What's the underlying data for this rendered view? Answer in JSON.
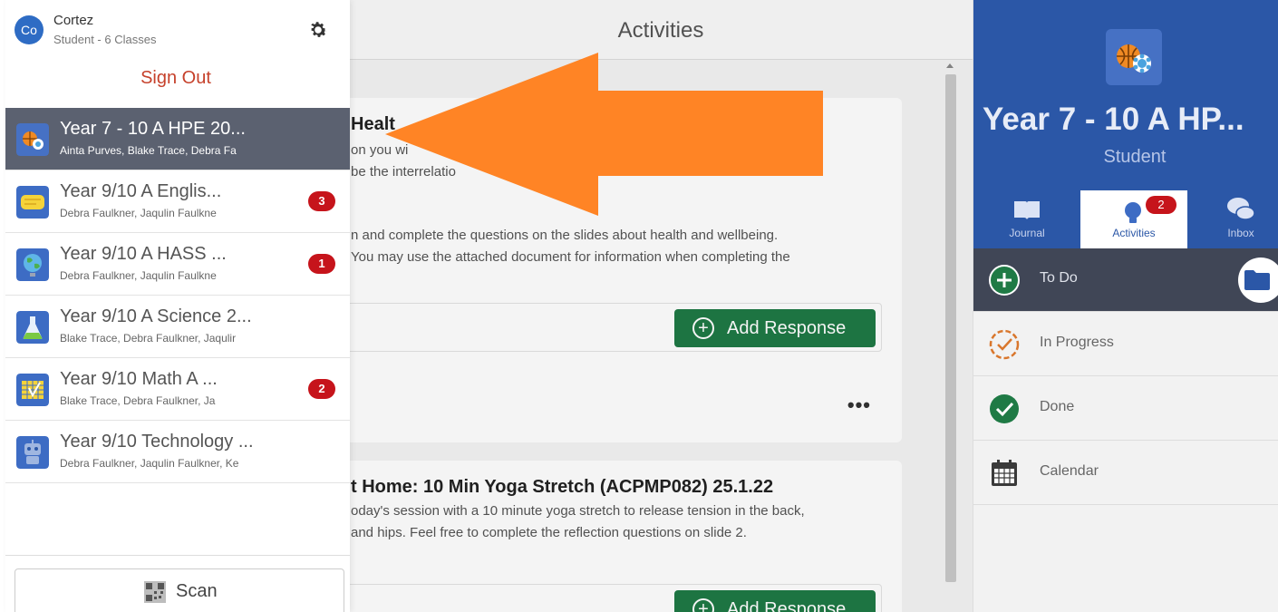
{
  "colors": {
    "hero_blue": "#2b57a7",
    "selected_item": "#5b6170",
    "todo_row": "#404656",
    "add_response_green": "#1f7a45",
    "badge_red": "#c6141b",
    "sign_out_red": "#c6412b",
    "arrow_orange": "#ff8425"
  },
  "profile": {
    "avatar": "Co",
    "name": "Cortez",
    "subtitle": "Student - 6 Classes",
    "settings_icon": "gear-icon"
  },
  "sign_out": "Sign Out",
  "classes": [
    {
      "name": "Year 7 - 10 A HPE 20...",
      "teachers": "Ainta Purves,  Blake Trace,  Debra Fa",
      "badge": "",
      "icon": "hpe-sports-icon",
      "selected": true
    },
    {
      "name": "Year 9/10 A Englis...",
      "teachers": "Debra Faulkner,  Jaqulin Faulkne",
      "badge": "3",
      "icon": "speech-bubble-icon"
    },
    {
      "name": "Year 9/10 A HASS ...",
      "teachers": "Debra Faulkner,  Jaqulin Faulkne",
      "badge": "1",
      "icon": "globe-icon"
    },
    {
      "name": "Year 9/10 A Science 2...",
      "teachers": "Blake Trace,  Debra Faulkner,  Jaqulir",
      "badge": "",
      "icon": "flask-icon"
    },
    {
      "name": "Year 9/10 Math A ...",
      "teachers": "Blake Trace,  Debra Faulkner,  Ja",
      "badge": "2",
      "icon": "calculator-icon"
    },
    {
      "name": "Year 9/10 Technology ...",
      "teachers": "Debra Faulkner,  Jaqulin Faulkner,  Ke",
      "badge": "",
      "icon": "robot-icon"
    }
  ],
  "scan": {
    "label": "Scan",
    "icon": "qr-code-icon"
  },
  "activities": {
    "title": "Activities",
    "posts": [
      {
        "title": "Healt",
        "lines": [
          "on you wi",
          "be the interrelatio",
          "n and complete the questions on the slides about health and wellbeing.",
          "You may use the attached document for information when completing the"
        ],
        "button": "Add Response",
        "more": "•••"
      },
      {
        "title": "t Home: 10 Min Yoga Stretch (ACPMP082) 25.1.22",
        "lines": [
          "oday's session with a 10 minute yoga stretch to release tension in the back,",
          "and hips. Feel free to complete the reflection questions on slide 2."
        ],
        "button": "Add Response"
      }
    ]
  },
  "class_panel": {
    "title": "Year 7 - 10 A HP...",
    "role": "Student",
    "icon": "hpe-sports-icon",
    "tabs": [
      {
        "label": "Journal",
        "icon": "book-icon"
      },
      {
        "label": "Activities",
        "icon": "lightbulb-icon",
        "badge": "2",
        "active": true
      },
      {
        "label": "Inbox",
        "icon": "chat-bubbles-icon"
      }
    ],
    "statuses": [
      {
        "label": "To Do",
        "icon": "plus-circle-icon",
        "active": true
      },
      {
        "label": "In Progress",
        "icon": "progress-check-icon"
      },
      {
        "label": "Done",
        "icon": "check-circle-icon"
      },
      {
        "label": "Calendar",
        "icon": "calendar-icon"
      }
    ]
  }
}
